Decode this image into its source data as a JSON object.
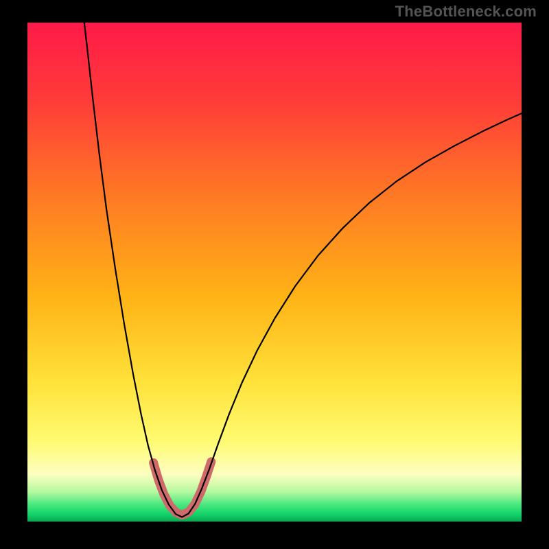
{
  "watermark": "TheBottleneck.com",
  "chart_data": {
    "type": "line",
    "title": "",
    "xlabel": "",
    "ylabel": "",
    "xlim": [
      0,
      100
    ],
    "ylim": [
      0,
      100
    ],
    "grid": false,
    "legend": false,
    "annotations": [],
    "background_gradient_stops": [
      {
        "offset": 0.0,
        "color": "#ff1a49"
      },
      {
        "offset": 0.15,
        "color": "#ff3a3a"
      },
      {
        "offset": 0.35,
        "color": "#ff7a24"
      },
      {
        "offset": 0.55,
        "color": "#ffb316"
      },
      {
        "offset": 0.72,
        "color": "#ffe23a"
      },
      {
        "offset": 0.84,
        "color": "#fffb72"
      },
      {
        "offset": 0.905,
        "color": "#fdfec0"
      },
      {
        "offset": 0.94,
        "color": "#b6f9a0"
      },
      {
        "offset": 0.965,
        "color": "#4de880"
      },
      {
        "offset": 0.985,
        "color": "#12d46a"
      },
      {
        "offset": 1.0,
        "color": "#0aa850"
      }
    ],
    "series": [
      {
        "name": "curve",
        "stroke": "#000000",
        "stroke_width": 2.2,
        "points": [
          {
            "x": 11.5,
            "y": 100.0
          },
          {
            "x": 12.2,
            "y": 94.0
          },
          {
            "x": 13.2,
            "y": 85.0
          },
          {
            "x": 14.5,
            "y": 74.0
          },
          {
            "x": 16.0,
            "y": 62.5
          },
          {
            "x": 17.8,
            "y": 50.5
          },
          {
            "x": 19.6,
            "y": 39.5
          },
          {
            "x": 21.4,
            "y": 29.5
          },
          {
            "x": 23.0,
            "y": 21.5
          },
          {
            "x": 24.4,
            "y": 15.3
          },
          {
            "x": 25.8,
            "y": 10.3
          },
          {
            "x": 27.2,
            "y": 6.3
          },
          {
            "x": 28.6,
            "y": 3.4
          },
          {
            "x": 30.0,
            "y": 1.5
          },
          {
            "x": 31.3,
            "y": 0.9
          },
          {
            "x": 32.6,
            "y": 1.6
          },
          {
            "x": 33.9,
            "y": 3.5
          },
          {
            "x": 35.2,
            "y": 6.4
          },
          {
            "x": 36.8,
            "y": 10.5
          },
          {
            "x": 38.6,
            "y": 15.6
          },
          {
            "x": 40.8,
            "y": 21.5
          },
          {
            "x": 43.4,
            "y": 27.8
          },
          {
            "x": 46.5,
            "y": 34.3
          },
          {
            "x": 50.1,
            "y": 40.8
          },
          {
            "x": 54.2,
            "y": 47.2
          },
          {
            "x": 58.8,
            "y": 53.3
          },
          {
            "x": 63.8,
            "y": 58.8
          },
          {
            "x": 69.1,
            "y": 63.8
          },
          {
            "x": 74.7,
            "y": 68.2
          },
          {
            "x": 80.5,
            "y": 72.0
          },
          {
            "x": 86.4,
            "y": 75.3
          },
          {
            "x": 92.3,
            "y": 78.3
          },
          {
            "x": 97.0,
            "y": 80.5
          },
          {
            "x": 100.0,
            "y": 81.8
          }
        ]
      },
      {
        "name": "highlight",
        "stroke": "#d06a6a",
        "stroke_width": 13,
        "linecap": "round",
        "points": [
          {
            "x": 25.5,
            "y": 11.8
          },
          {
            "x": 26.5,
            "y": 8.4
          },
          {
            "x": 27.6,
            "y": 5.5
          },
          {
            "x": 28.8,
            "y": 3.2
          },
          {
            "x": 30.1,
            "y": 1.8
          },
          {
            "x": 31.3,
            "y": 1.3
          },
          {
            "x": 32.6,
            "y": 1.9
          },
          {
            "x": 33.9,
            "y": 3.5
          },
          {
            "x": 35.1,
            "y": 6.0
          },
          {
            "x": 36.2,
            "y": 9.0
          },
          {
            "x": 37.2,
            "y": 12.0
          }
        ]
      }
    ]
  }
}
